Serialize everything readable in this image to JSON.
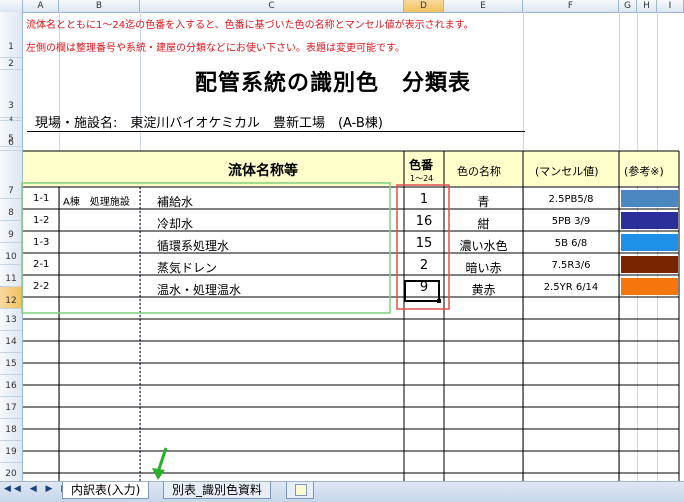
{
  "columns": [
    "A",
    "B",
    "C",
    "D",
    "E",
    "F",
    "G",
    "H",
    "I"
  ],
  "selected_column": "D",
  "row_numbers": [
    "1",
    "2",
    "3",
    "4",
    "5",
    "6",
    "7",
    "8",
    "9",
    "10",
    "11",
    "12",
    "13",
    "14",
    "15",
    "16",
    "17",
    "18",
    "19",
    "20"
  ],
  "selected_row": "12",
  "notes": [
    "流体名とともに1～24迄の色番を入すると、色番に基づいた色の名称とマンセル値が表示されます。",
    "左側の欄は整理番号や系統・建屋の分類などにお使い下さい。表題は変更可能です。"
  ],
  "title": "配管系統の識別色　分類表",
  "site_label": "現場・施設名:　東淀川バイオケミカル　豊新工場　(A-B棟)",
  "headers": {
    "fluid_name": "流体名称等",
    "color_no": "色番",
    "color_no_range": "1～24",
    "color_name": "色の名称",
    "munsell": "(マンセル値)",
    "reference": "(参考※)"
  },
  "rows": [
    {
      "no": "1-1",
      "building": "A棟　処理施設",
      "fluid": "補給水",
      "color_no": "1",
      "color_name": "青",
      "munsell": "2.5PB5/8",
      "swatch": "#4a86c0"
    },
    {
      "no": "1-2",
      "building": "",
      "fluid": "冷却水",
      "color_no": "16",
      "color_name": "紺",
      "munsell": "5PB 3/9",
      "swatch": "#2b2f9a"
    },
    {
      "no": "1-3",
      "building": "",
      "fluid": "循環系処理水",
      "color_no": "15",
      "color_name": "濃い水色",
      "munsell": "5B 6/8",
      "swatch": "#1f90e8"
    },
    {
      "no": "2-1",
      "building": "",
      "fluid": "蒸気ドレン",
      "color_no": "2",
      "color_name": "暗い赤",
      "munsell": "7.5R3/6",
      "swatch": "#7b2400"
    },
    {
      "no": "2-2",
      "building": "",
      "fluid": "温水・処理温水",
      "color_no": "9",
      "color_name": "黄赤",
      "munsell": "2.5YR 6/14",
      "swatch": "#f4760c"
    }
  ],
  "sheet_tabs": [
    "内訳表(入力)",
    "別表_識別色資料"
  ],
  "colors": {
    "header_fill": "#ffffcc",
    "note_text": "#e0151c",
    "green_box": "#7fd07f",
    "red_box": "#e05050",
    "arrow": "#28b028"
  }
}
